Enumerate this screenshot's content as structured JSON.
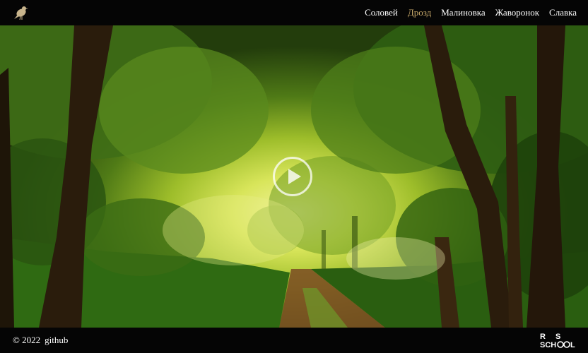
{
  "header": {
    "logo_icon": "bird-icon",
    "nav": [
      {
        "label": "Соловей",
        "active": false
      },
      {
        "label": "Дрозд",
        "active": true
      },
      {
        "label": "Малиновка",
        "active": false
      },
      {
        "label": "Жаворонок",
        "active": false
      },
      {
        "label": "Славка",
        "active": false
      }
    ]
  },
  "main": {
    "play_icon": "play-icon"
  },
  "footer": {
    "copyright": "© 2022",
    "github": "github",
    "school_logo": "RS SCHOOL"
  },
  "colors": {
    "active_nav": "#c8a96a",
    "bar_background": "#050505"
  }
}
